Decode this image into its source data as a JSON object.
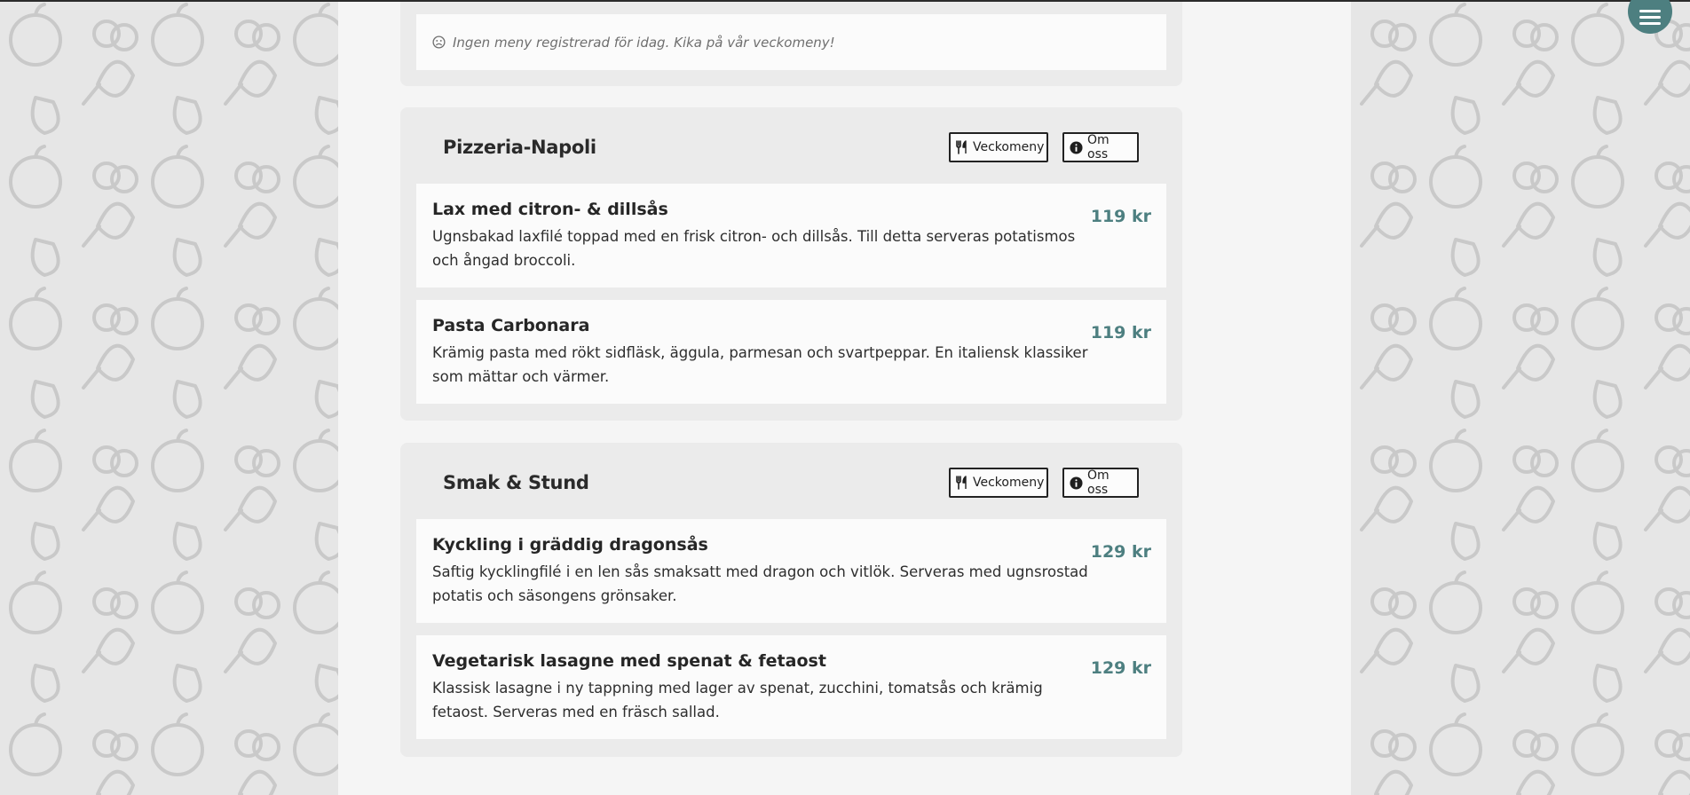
{
  "notice": {
    "text": "Ingen meny registrerad för idag. Kika på vår veckomeny!"
  },
  "buttons": {
    "weekly_menu": "Veckomeny",
    "about": "Om oss"
  },
  "restaurants": [
    {
      "name": "Pizzeria-Napoli",
      "dishes": [
        {
          "name": "Lax med citron- & dillsås",
          "description": "Ugnsbakad laxfilé toppad med en frisk citron- och dillsås. Till detta serveras potatismos och ångad broccoli.",
          "price": "119 kr"
        },
        {
          "name": "Pasta Carbonara",
          "description": "Krämig pasta med rökt sidfläsk, äggula, parmesan och svartpeppar. En italiensk klassiker som mättar och värmer.",
          "price": "119 kr"
        }
      ]
    },
    {
      "name": "Smak & Stund",
      "dishes": [
        {
          "name": "Kyckling i gräddig dragonsås",
          "description": "Saftig kycklingfilé i en len sås smaksatt med dragon och vitlök. Serveras med ugnsrostad potatis och säsongens grönsaker.",
          "price": "129 kr"
        },
        {
          "name": "Vegetarisk lasagne med spenat & fetaost",
          "description": "Klassisk lasagne i ny tappning med lager av spenat, zucchini, tomatsås och krämig fetaost. Serveras med en fräsch sallad.",
          "price": "129 kr"
        }
      ]
    }
  ],
  "colors": {
    "accent": "#4d7f80",
    "page_bg": "#f5f5f5",
    "card_bg": "#ebebeb",
    "item_bg": "#fbfbfb",
    "pattern_bg": "#e6e6e6"
  },
  "icons": {
    "menu": "hamburger-icon",
    "weekly_menu": "utensils-icon",
    "about": "info-circle-icon",
    "notice": "frown-icon"
  }
}
